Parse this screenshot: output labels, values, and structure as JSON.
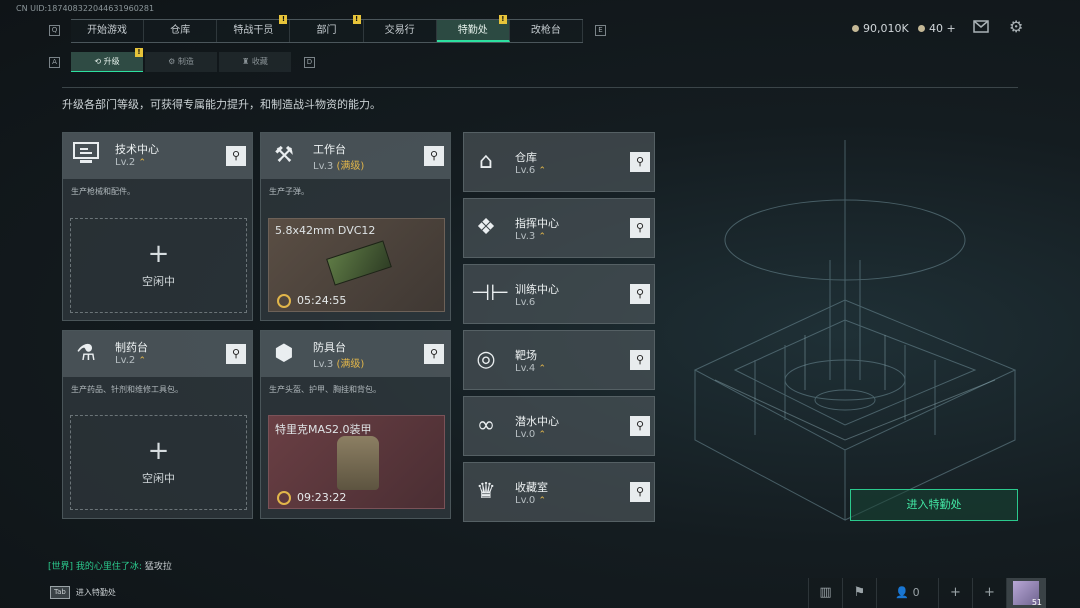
{
  "uid": "CN UID:187408322044631960281",
  "nav": {
    "left_key": "Q",
    "right_key": "E",
    "tabs": [
      {
        "label": "开始游戏",
        "badge": ""
      },
      {
        "label": "仓库",
        "badge": ""
      },
      {
        "label": "特战干员",
        "badge": "!"
      },
      {
        "label": "部门",
        "badge": "!"
      },
      {
        "label": "交易行",
        "badge": ""
      },
      {
        "label": "特勤处",
        "badge": "!",
        "active": true
      },
      {
        "label": "改枪台",
        "badge": ""
      }
    ]
  },
  "subnav": {
    "left_key": "A",
    "right_key": "D",
    "tabs": [
      {
        "label": "升级",
        "icon": "upgrade-icon",
        "badge": "!"
      },
      {
        "label": "制造",
        "icon": "craft-icon"
      },
      {
        "label": "收藏",
        "icon": "collection-icon"
      }
    ]
  },
  "currency": {
    "money": "90,010K",
    "tickets": "40 +"
  },
  "description": "升级各部门等级，可获得专属能力提升，和制造战斗物资的能力。",
  "cards": {
    "tech": {
      "title": "技术中心",
      "level": "Lv.2",
      "desc": "生产枪械和配件。",
      "idle_label": "空闲中",
      "icon": "computer-icon"
    },
    "workbench": {
      "title": "工作台",
      "level": "Lv.3",
      "max": "(满级)",
      "desc": "生产子弹。",
      "item": "5.8x42mm DVC12",
      "time": "05:24:55",
      "icon": "tools-icon"
    },
    "pharmacy": {
      "title": "制药台",
      "level": "Lv.2",
      "desc": "生产药品、针剂和维修工具包。",
      "idle_label": "空闲中",
      "icon": "microscope-icon"
    },
    "armor": {
      "title": "防具台",
      "level": "Lv.3",
      "max": "(满级)",
      "desc": "生产头盔、护甲、胸挂和背包。",
      "item": "特里克MAS2.0装甲",
      "time": "09:23:22",
      "icon": "cubes-icon"
    }
  },
  "right_cards": [
    {
      "title": "仓库",
      "level": "Lv.6",
      "icon": "warehouse-icon"
    },
    {
      "title": "指挥中心",
      "level": "Lv.3",
      "icon": "command-icon"
    },
    {
      "title": "训练中心",
      "level": "Lv.6",
      "icon": "dumbbell-icon"
    },
    {
      "title": "靶场",
      "level": "Lv.4",
      "icon": "target-icon"
    },
    {
      "title": "潜水中心",
      "level": "Lv.0",
      "icon": "diving-mask-icon"
    },
    {
      "title": "收藏室",
      "level": "Lv.0",
      "icon": "trophy-icon"
    }
  ],
  "enter_button": "进入特勤处",
  "chat": {
    "channel": "[世界]",
    "name": "我的心里住了冰:",
    "message": "猛攻拉"
  },
  "bottom": {
    "key": "Tab",
    "label": "进入特勤处",
    "friends": "0",
    "level_badge": "51"
  }
}
